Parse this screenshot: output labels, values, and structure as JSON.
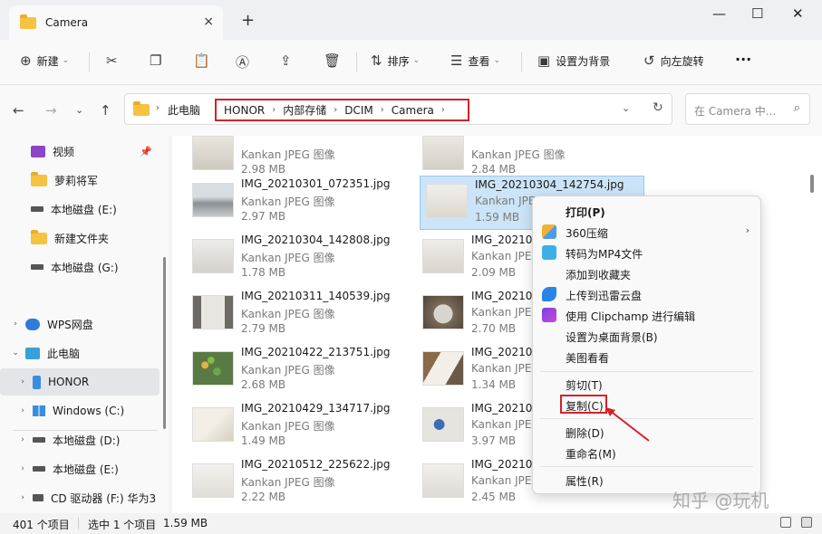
{
  "window": {
    "tab_title": "Camera",
    "tab_close_icon": "×",
    "new_tab_icon": "+",
    "minimize_icon": "—",
    "maximize_icon": "☐",
    "close_icon": "✕"
  },
  "toolbar": {
    "new_label": "新建",
    "sort_label": "排序",
    "view_label": "查看",
    "set_background_label": "设置为背景",
    "rotate_left_label": "向左旋转",
    "more_icon": "···",
    "icons": [
      "plus-circle-icon",
      "scissors-icon",
      "copy-icon",
      "paste-icon",
      "rename-icon",
      "share-icon",
      "delete-icon",
      "sort-icon",
      "view-icon",
      "background-icon",
      "rotate-left-icon"
    ]
  },
  "address": {
    "crumbs": [
      "此电脑",
      "HONOR",
      "内部存储",
      "DCIM",
      "Camera"
    ],
    "search_placeholder": "在 Camera 中..."
  },
  "sidebar": {
    "items": [
      {
        "label": "视频",
        "icon": "video-icon"
      },
      {
        "label": "萝莉将军",
        "icon": "folder-icon"
      },
      {
        "label": "本地磁盘 (E:)",
        "icon": "drive-icon"
      },
      {
        "label": "新建文件夹",
        "icon": "folder-icon"
      },
      {
        "label": "本地磁盘 (G:)",
        "icon": "drive-icon"
      },
      {
        "label": "WPS网盘",
        "icon": "cloud-icon"
      },
      {
        "label": "此电脑",
        "icon": "computer-icon"
      },
      {
        "label": "HONOR",
        "icon": "phone-icon"
      },
      {
        "label": "Windows (C:)",
        "icon": "windows-drive-icon"
      },
      {
        "label": "本地磁盘 (D:)",
        "icon": "drive-icon"
      },
      {
        "label": "本地磁盘 (E:)",
        "icon": "drive-icon"
      },
      {
        "label": "CD 驱动器 (F:) 华为3",
        "icon": "cd-drive-icon"
      }
    ]
  },
  "files": {
    "left": [
      {
        "name": "",
        "type": "Kankan JPEG 图像",
        "size": "2.98 MB"
      },
      {
        "name": "IMG_20210301_072351.jpg",
        "type": "Kankan JPEG 图像",
        "size": "2.97 MB"
      },
      {
        "name": "IMG_20210304_142808.jpg",
        "type": "Kankan JPEG 图像",
        "size": "1.78 MB"
      },
      {
        "name": "IMG_20210311_140539.jpg",
        "type": "Kankan JPEG 图像",
        "size": "2.79 MB"
      },
      {
        "name": "IMG_20210422_213751.jpg",
        "type": "Kankan JPEG 图像",
        "size": "2.68 MB"
      },
      {
        "name": "IMG_20210429_134717.jpg",
        "type": "Kankan JPEG 图像",
        "size": "1.49 MB"
      },
      {
        "name": "IMG_20210512_225622.jpg",
        "type": "Kankan JPEG 图像",
        "size": "2.22 MB"
      }
    ],
    "right": [
      {
        "name": "",
        "type": "Kankan JPEG 图像",
        "size": "2.84 MB"
      },
      {
        "name": "IMG_20210304_142754.jpg",
        "type": "Kankan JPEG",
        "size": "1.59 MB"
      },
      {
        "name": "IMG_202103",
        "type": "Kankan JPEG",
        "size": "2.09 MB"
      },
      {
        "name": "IMG_202104",
        "type": "Kankan JPEG",
        "size": "2.70 MB"
      },
      {
        "name": "IMG_202104",
        "type": "Kankan JPEG",
        "size": "1.34 MB"
      },
      {
        "name": "IMG_202105",
        "type": "Kankan JPEG",
        "size": "3.97 MB"
      },
      {
        "name": "IMG_202105",
        "type": "Kankan JPEG",
        "size": "2.45 MB"
      }
    ]
  },
  "context_menu": {
    "items": [
      {
        "label": "打印(P)",
        "icon": ""
      },
      {
        "label": "360压缩",
        "icon": "compress-360-icon",
        "submenu": "›"
      },
      {
        "label": "转码为MP4文件",
        "icon": "mp4-convert-icon"
      },
      {
        "label": "添加到收藏夹",
        "icon": ""
      },
      {
        "label": "上传到迅雷云盘",
        "icon": "xunlei-icon"
      },
      {
        "label": "使用 Clipchamp 进行编辑",
        "icon": "clipchamp-icon"
      },
      {
        "label": "设置为桌面背景(B)",
        "icon": ""
      },
      {
        "label": "美图看看",
        "icon": ""
      },
      {
        "label": "剪切(T)",
        "icon": ""
      },
      {
        "label": "复制(C)",
        "icon": ""
      },
      {
        "label": "删除(D)",
        "icon": ""
      },
      {
        "label": "重命名(M)",
        "icon": ""
      },
      {
        "label": "属性(R)",
        "icon": ""
      }
    ]
  },
  "status": {
    "count": "401 个项目",
    "selected": "选中 1 个项目",
    "size": "1.59 MB"
  },
  "watermark": "知乎 @玩机",
  "colors": {
    "highlight_red": "#d6202a",
    "selection_blue": "#cce4f7",
    "folder_yellow": "#f5c242"
  }
}
